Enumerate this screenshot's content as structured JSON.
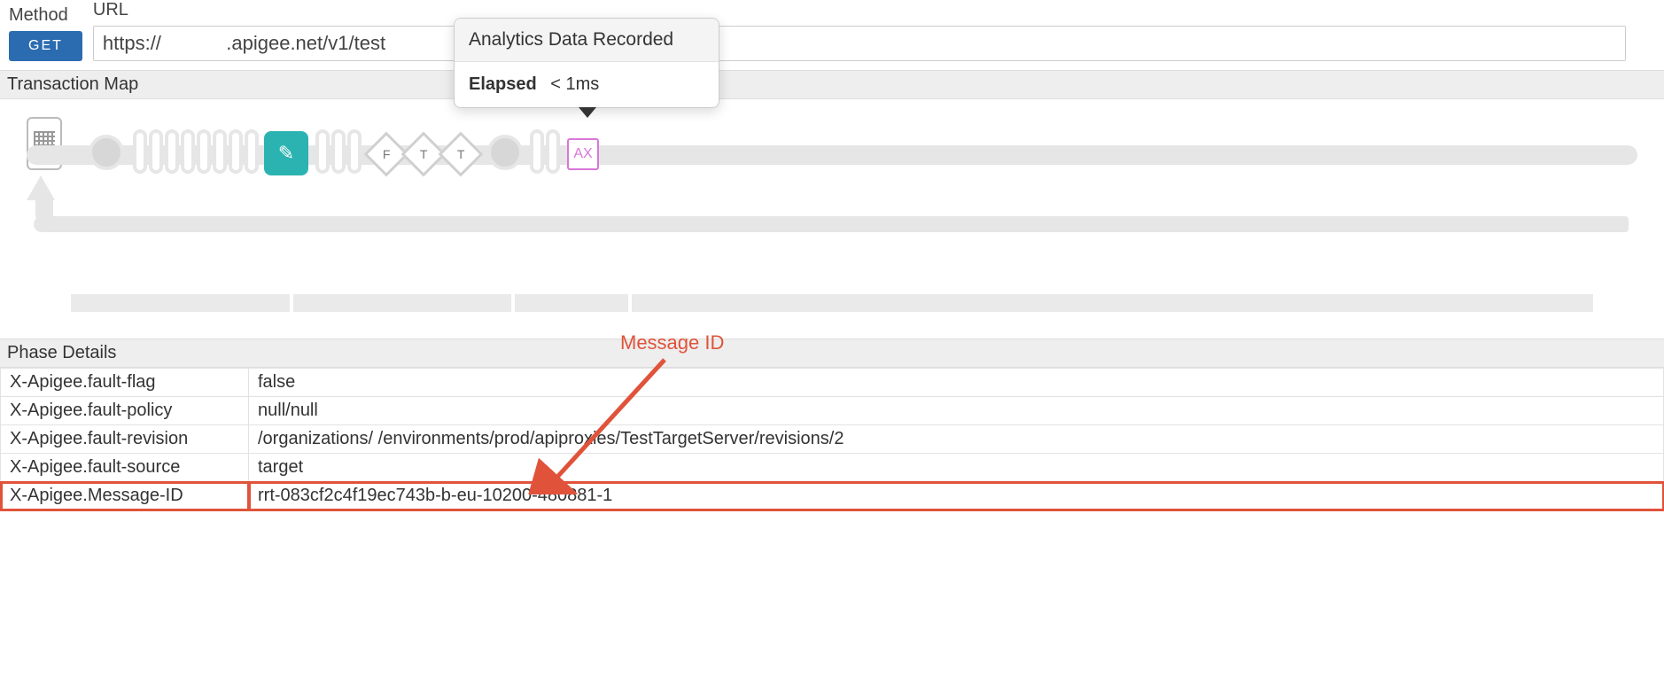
{
  "request": {
    "method_label": "Method",
    "method": "GET",
    "url_label": "URL",
    "url": "https://            .apigee.net/v1/test"
  },
  "transaction_map": {
    "title": "Transaction Map",
    "diamonds": [
      "F",
      "T",
      "T"
    ],
    "ax_label": "AX"
  },
  "tooltip": {
    "title": "Analytics Data Recorded",
    "elapsed_label": "Elapsed",
    "elapsed_value": "< 1ms"
  },
  "phase_details": {
    "title": "Phase Details",
    "rows": [
      {
        "k": "X-Apigee.fault-flag",
        "v": "false"
      },
      {
        "k": "X-Apigee.fault-policy",
        "v": "null/null"
      },
      {
        "k": "X-Apigee.fault-revision",
        "v": "/organizations/            /environments/prod/apiproxies/TestTargetServer/revisions/2"
      },
      {
        "k": "X-Apigee.fault-source",
        "v": "target"
      },
      {
        "k": "X-Apigee.Message-ID",
        "v": "rrt-083cf2c4f19ec743b-b-eu-10200-480881-1"
      }
    ]
  },
  "annotation": {
    "label": "Message ID"
  },
  "colors": {
    "method_btn": "#2b6cb0",
    "teal": "#2bb3b1",
    "ax_border": "#d976d9",
    "annotation": "#e0533a"
  }
}
